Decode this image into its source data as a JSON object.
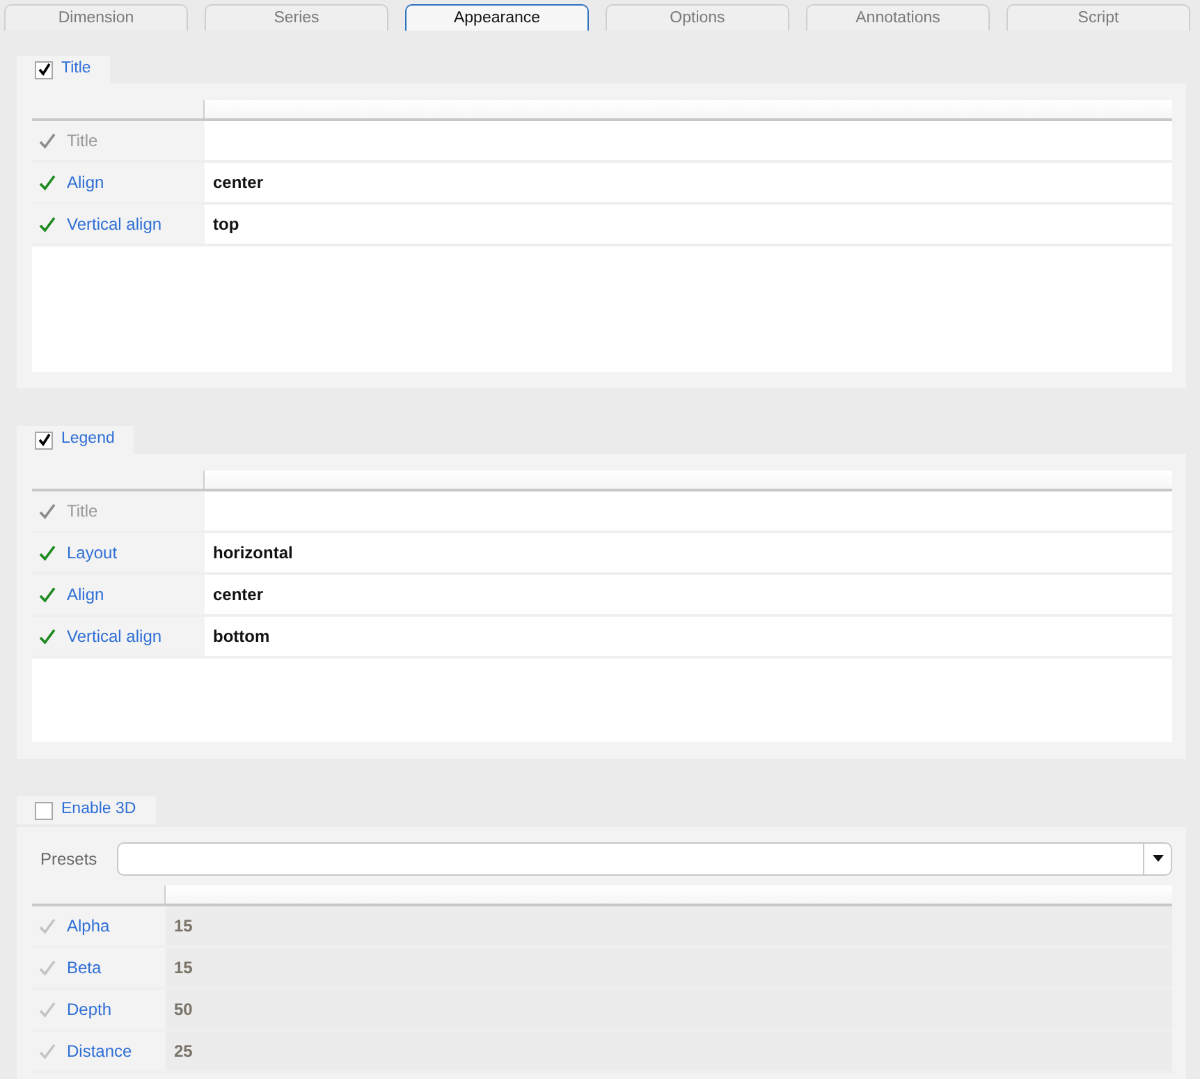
{
  "tabs": [
    {
      "label": "Dimension",
      "selected": false
    },
    {
      "label": "Series",
      "selected": false
    },
    {
      "label": "Appearance",
      "selected": true
    },
    {
      "label": "Options",
      "selected": false
    },
    {
      "label": "Annotations",
      "selected": false
    },
    {
      "label": "Script",
      "selected": false
    }
  ],
  "sections": [
    {
      "label": "Title",
      "checked": true,
      "properties": [
        {
          "name": "Title",
          "set": false
        },
        {
          "name": "Align",
          "set": true,
          "value": "center"
        },
        {
          "name": "Vertical align",
          "set": true,
          "value": "top"
        }
      ]
    },
    {
      "label": "Legend",
      "checked": true,
      "properties": [
        {
          "name": "Title",
          "set": false
        },
        {
          "name": "Layout",
          "set": true,
          "value": "horizontal"
        },
        {
          "name": "Align",
          "set": true,
          "value": "center"
        },
        {
          "name": "Vertical align",
          "set": true,
          "value": "bottom"
        }
      ]
    },
    {
      "label": "Enable 3D",
      "checked": false,
      "presets": {
        "label": "Presets"
      },
      "properties": [
        {
          "name": "Alpha",
          "set": false,
          "value": "15"
        },
        {
          "name": "Beta",
          "set": false,
          "value": "15"
        },
        {
          "name": "Depth",
          "set": false,
          "value": "50"
        },
        {
          "name": "Distance",
          "set": false,
          "value": "25"
        }
      ]
    }
  ]
}
